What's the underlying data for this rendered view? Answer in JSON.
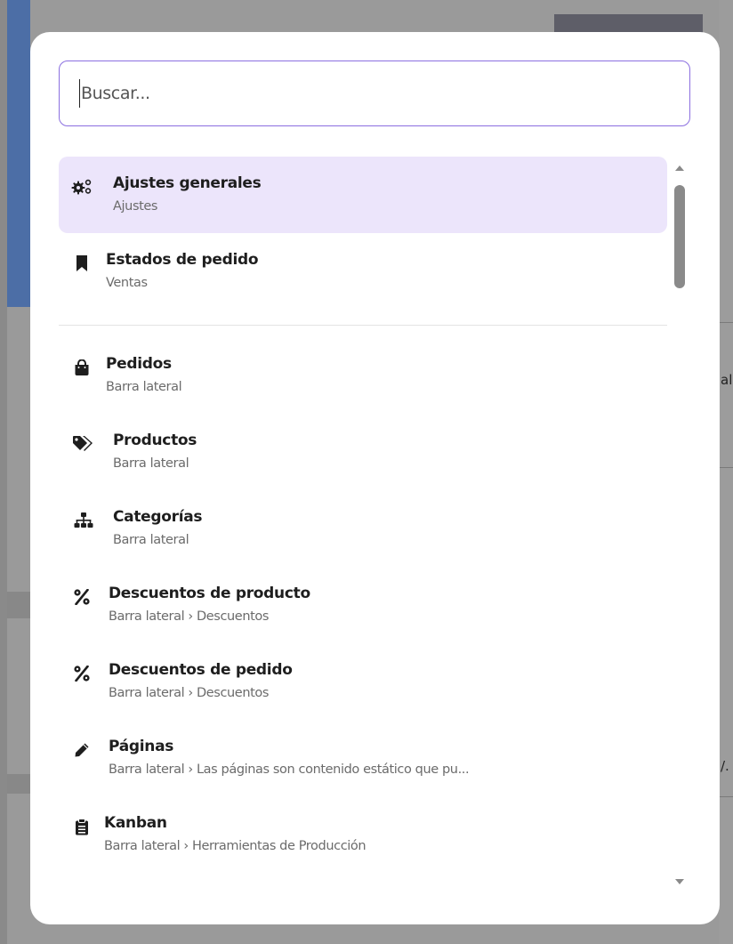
{
  "search": {
    "placeholder": "Buscar..."
  },
  "results": [
    {
      "icon": "cogs-icon",
      "title": "Ajustes generales",
      "subtitle": "Ajustes",
      "active": true
    },
    {
      "icon": "bookmark-icon",
      "title": "Estados de pedido",
      "subtitle": "Ventas",
      "active": false
    },
    {
      "icon": "shopping-bag-icon",
      "title": "Pedidos",
      "subtitle": "Barra lateral",
      "active": false
    },
    {
      "icon": "tags-icon",
      "title": "Productos",
      "subtitle": "Barra lateral",
      "active": false
    },
    {
      "icon": "sitemap-icon",
      "title": "Categorías",
      "subtitle": "Barra lateral",
      "active": false
    },
    {
      "icon": "percent-icon",
      "title": "Descuentos de producto",
      "subtitle": "Barra lateral › Descuentos",
      "active": false
    },
    {
      "icon": "percent-icon",
      "title": "Descuentos de pedido",
      "subtitle": "Barra lateral › Descuentos",
      "active": false
    },
    {
      "icon": "pencil-icon",
      "title": "Páginas",
      "subtitle": "Barra lateral › Las páginas son contenido estático que pu...",
      "active": false
    },
    {
      "icon": "clipboard-icon",
      "title": "Kanban",
      "subtitle": "Barra lateral › Herramientas de Producción",
      "active": false
    }
  ],
  "background": {
    "right_text_1": "al:",
    "right_text_2": "/."
  },
  "colors": {
    "accent": "#8b6fe0",
    "active_bg": "#ece5fb",
    "overlay": "#8a8a8a"
  }
}
